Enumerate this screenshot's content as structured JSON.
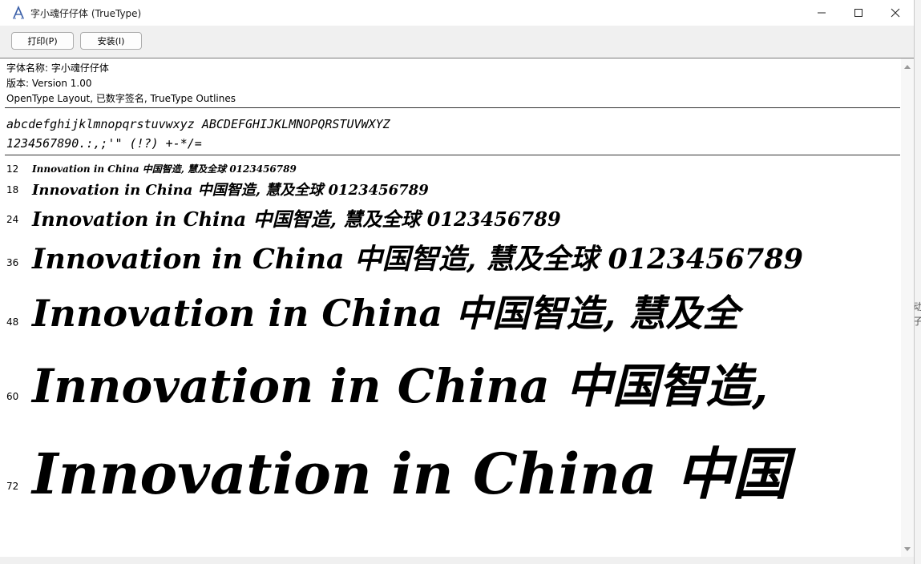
{
  "window": {
    "title": "字小魂仔仔体 (TrueType)",
    "icon": "font-viewer-icon"
  },
  "toolbar": {
    "print_label": "打印(P)",
    "install_label": "安装(I)"
  },
  "font_info": {
    "name_line": "字体名称: 字小魂仔仔体",
    "version_line": "版本: Version 1.00",
    "type_line": "OpenType Layout, 已数字签名, TrueType Outlines"
  },
  "charset": {
    "letters": "abcdefghijklmnopqrstuvwxyz ABCDEFGHIJKLMNOPQRSTUVWXYZ",
    "digits_symbols": "1234567890.:,;'\" (!?) +-*/="
  },
  "samples": [
    {
      "size": "12",
      "text": "Innovation in China 中国智造, 慧及全球 0123456789"
    },
    {
      "size": "18",
      "text": "Innovation in China 中国智造, 慧及全球 0123456789"
    },
    {
      "size": "24",
      "text": "Innovation in China 中国智造, 慧及全球 0123456789"
    },
    {
      "size": "36",
      "text": "Innovation in China 中国智造, 慧及全球 0123456789"
    },
    {
      "size": "48",
      "text": "Innovation in China 中国智造, 慧及全"
    },
    {
      "size": "60",
      "text": "Innovation in China 中国智造,"
    },
    {
      "size": "72",
      "text": "Innovation in China 中国"
    }
  ],
  "background_window": {
    "fragment_1": "动",
    "fragment_2": "子"
  }
}
